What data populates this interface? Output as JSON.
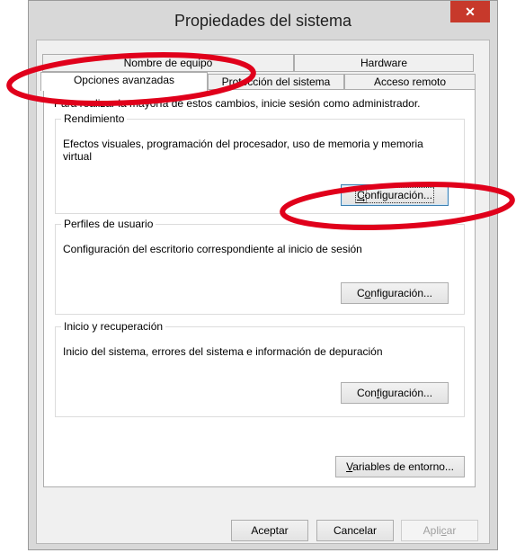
{
  "window": {
    "title": "Propiedades del sistema",
    "close_glyph": "✕"
  },
  "tabs": {
    "row_back": [
      {
        "label": "Nombre de equipo"
      },
      {
        "label": "Hardware"
      }
    ],
    "row_front": [
      {
        "label": "Opciones avanzadas",
        "selected": true
      },
      {
        "label": "Protección del sistema"
      },
      {
        "label": "Acceso remoto"
      }
    ]
  },
  "panel": {
    "hint": "Para realizar la mayoría de estos cambios, inicie sesión como administrador.",
    "groups": [
      {
        "title": "Rendimiento",
        "description": "Efectos visuales, programación del procesador, uso de memoria y memoria virtual",
        "button": {
          "mnemonic": "C",
          "rest": "onfiguración..."
        }
      },
      {
        "title": "Perfiles de usuario",
        "description": "Configuración del escritorio correspondiente al inicio de sesión",
        "button": {
          "mnemonic": "o",
          "pre": "C",
          "rest": "nfiguración..."
        }
      },
      {
        "title": "Inicio y recuperación",
        "description": "Inicio del sistema, errores del sistema e información de depuración",
        "button": {
          "mnemonic": "f",
          "pre": "Con",
          "rest": "iguración..."
        }
      }
    ],
    "env_button": {
      "mnemonic": "V",
      "rest": "ariables de entorno..."
    }
  },
  "footer": {
    "ok": "Aceptar",
    "cancel": "Cancelar",
    "apply": {
      "pre": "Apli",
      "mnemonic": "c",
      "rest": "ar"
    }
  },
  "colors": {
    "annotation": "#e0001b",
    "close": "#c7392b",
    "focus": "#3c7fb1"
  }
}
